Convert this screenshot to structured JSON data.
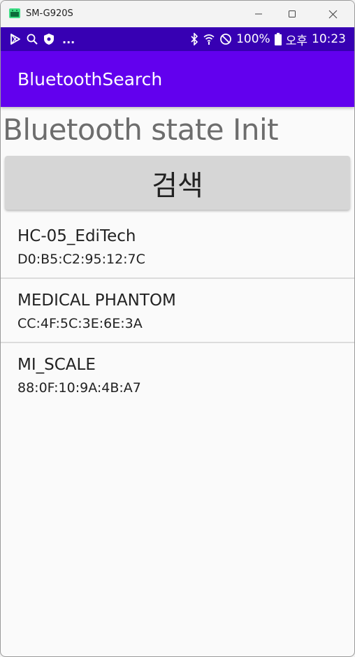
{
  "window": {
    "title": "SM-G920S",
    "icons": [
      "android-app-icon",
      "minimize-icon",
      "maximize-icon",
      "close-icon"
    ]
  },
  "status_bar": {
    "dots": "...",
    "battery": "100%",
    "ampm": "오후",
    "time": "10:23",
    "icons": [
      "play-store-icon",
      "search-icon",
      "shield-icon",
      "bluetooth-icon",
      "wifi-icon",
      "do-not-disturb-icon",
      "battery-icon"
    ]
  },
  "app_bar": {
    "title": "BluetoothSearch"
  },
  "main": {
    "state_text": "Bluetooth state Init",
    "search_button": "검색"
  },
  "devices": [
    {
      "name": "HC-05_EdiTech",
      "address": "D0:B5:C2:95:12:7C"
    },
    {
      "name": "MEDICAL PHANTOM",
      "address": "CC:4F:5C:3E:6E:3A"
    },
    {
      "name": "MI_SCALE",
      "address": "88:0F:10:9A:4B:A7"
    }
  ],
  "colors": {
    "status_bar": "#3700b3",
    "app_bar": "#6200ee",
    "button": "#d6d6d6",
    "state_text": "#6d6d6d"
  }
}
